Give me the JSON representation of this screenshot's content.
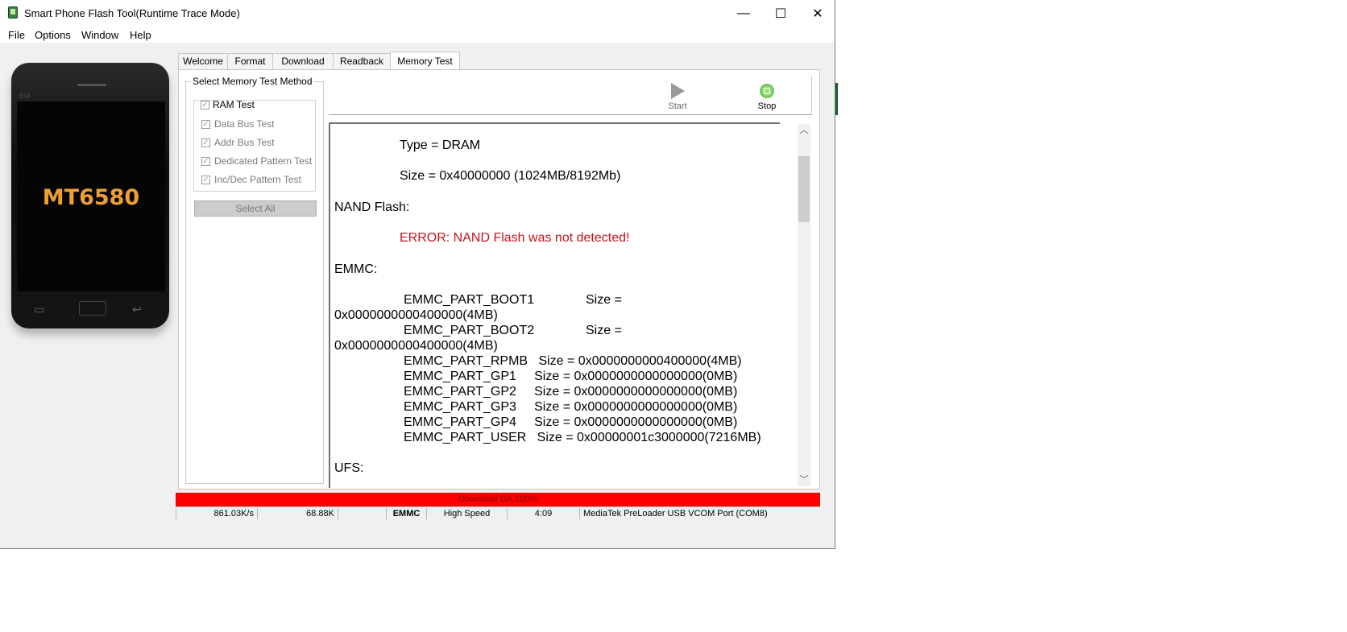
{
  "window": {
    "title": "Smart Phone Flash Tool(Runtime Trace Mode)",
    "controls": {
      "minimize": "—",
      "maximize": "☐",
      "close": "✕"
    }
  },
  "menu": [
    "File",
    "Options",
    "Window",
    "Help"
  ],
  "phone": {
    "brand": "BM",
    "chip": "MT6580"
  },
  "tabs": [
    "Welcome",
    "Format",
    "Download",
    "Readback",
    "Memory Test"
  ],
  "active_tab": "Memory Test",
  "memory_test": {
    "group_title": "Select Memory Test Method",
    "ram_test": {
      "label": "RAM Test",
      "checked": true
    },
    "options": [
      {
        "label": "Data Bus Test",
        "checked": true
      },
      {
        "label": "Addr Bus Test",
        "checked": true
      },
      {
        "label": "Dedicated Pattern Test",
        "checked": true
      },
      {
        "label": "Inc/Dec Pattern Test",
        "checked": true
      }
    ],
    "select_all_label": "Select All"
  },
  "toolbar": {
    "start_label": "Start",
    "stop_label": "Stop"
  },
  "log_lines": [
    {
      "text": "Type = DRAM"
    },
    {
      "text": "Size = 0x40000000 (1024MB/8192Mb)"
    },
    {
      "text": "NAND Flash:"
    },
    {
      "text": "ERROR: NAND Flash was not detected!",
      "error": true
    },
    {
      "text": "EMMC:"
    },
    {
      "text": "EMMC_PART_BOOT1"
    },
    {
      "text": "Size ="
    },
    {
      "text": "0x0000000000400000(4MB)"
    },
    {
      "text": "EMMC_PART_BOOT2"
    },
    {
      "text": "Size ="
    },
    {
      "text": "0x0000000000400000(4MB)"
    },
    {
      "text": "EMMC_PART_RPMB   Size = 0x0000000000400000(4MB)"
    },
    {
      "text": "EMMC_PART_GP1     Size = 0x0000000000000000(0MB)"
    },
    {
      "text": "EMMC_PART_GP2     Size = 0x0000000000000000(0MB)"
    },
    {
      "text": "EMMC_PART_GP3     Size = 0x0000000000000000(0MB)"
    },
    {
      "text": "EMMC_PART_GP4     Size = 0x0000000000000000(0MB)"
    },
    {
      "text": "EMMC_PART_USER   Size = 0x00000001c3000000(7216MB)"
    },
    {
      "text": "UFS:"
    }
  ],
  "progress": {
    "label": "Download DA 100%",
    "percent": 100,
    "color": "#ff0000"
  },
  "status": {
    "speed": "861.03K/s",
    "size": "68.88K",
    "blank": "",
    "storage": "EMMC",
    "usb_speed": "High Speed",
    "time": "4:09",
    "port": "MediaTek PreLoader USB VCOM Port (COM8)"
  }
}
